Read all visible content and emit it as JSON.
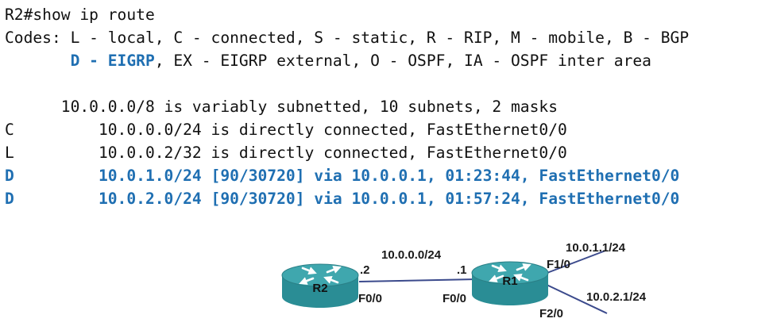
{
  "terminal": {
    "prompt_line": "R2#show ip route",
    "codes_line1": "Codes: L - local, C - connected, S - static, R - RIP, M - mobile, B - BGP",
    "codes_line2_indent": "       ",
    "codes_line2_highlight": "D - EIGRP",
    "codes_line2_rest": ", EX - EIGRP external, O - OSPF, IA - OSPF inter area",
    "blank": " ",
    "summary_line": "      10.0.0.0/8 is variably subnetted, 10 subnets, 2 masks",
    "routes": [
      {
        "code": "C",
        "gap": "         ",
        "text": "10.0.0.0/24 is directly connected, FastEthernet0/0",
        "highlight": false
      },
      {
        "code": "L",
        "gap": "         ",
        "text": "10.0.0.2/32 is directly connected, FastEthernet0/0",
        "highlight": false
      },
      {
        "code": "D",
        "gap": "         ",
        "text": "10.0.1.0/24 [90/30720] via 10.0.0.1, 01:23:44, FastEthernet0/0",
        "highlight": true
      },
      {
        "code": "D",
        "gap": "         ",
        "text": "10.0.2.0/24 [90/30720] via 10.0.0.1, 01:57:24, FastEthernet0/0",
        "highlight": true
      }
    ]
  },
  "colors": {
    "highlight": "#1f6fb2",
    "router_body": "#2a8d95",
    "router_top": "#3fa7ae",
    "link": "#3b4a8c"
  },
  "topology": {
    "r2_name": "R2",
    "r1_name": "R1",
    "lan_network": "10.0.0.0/24",
    "r2_host": ".2",
    "r1_host": ".1",
    "r2_iface": "F0/0",
    "r1_iface": "F0/0",
    "r1_f1_iface": "F1/0",
    "r1_f1_net": "10.0.1.1/24",
    "r1_f2_iface": "F2/0",
    "r1_f2_net": "10.0.2.1/24"
  }
}
